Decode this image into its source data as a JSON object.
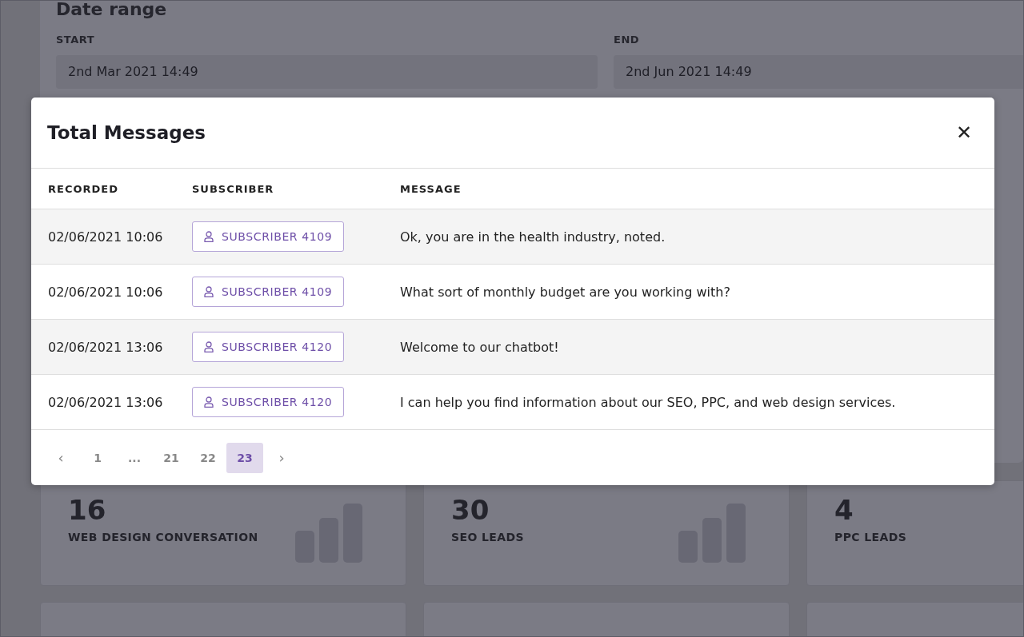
{
  "date_range": {
    "title": "Date range",
    "start": {
      "label": "START",
      "value": "2nd Mar 2021 14:49"
    },
    "end": {
      "label": "END",
      "value": "2nd Jun 2021 14:49"
    }
  },
  "stats": [
    {
      "value": "16",
      "label": "WEB DESIGN CONVERSATION"
    },
    {
      "value": "30",
      "label": "SEO LEADS"
    },
    {
      "value": "4",
      "label": "PPC LEADS"
    }
  ],
  "modal": {
    "title": "Total Messages",
    "close": "✕",
    "table": {
      "columns": [
        "RECORDED",
        "SUBSCRIBER",
        "MESSAGE"
      ],
      "rows": [
        {
          "recorded": "02/06/2021 10:06",
          "subscriber": "SUBSCRIBER 4109",
          "message": "Ok, you are in the health industry, noted."
        },
        {
          "recorded": "02/06/2021 10:06",
          "subscriber": "SUBSCRIBER 4109",
          "message": "What sort of monthly budget are you working with?"
        },
        {
          "recorded": "02/06/2021 13:06",
          "subscriber": "SUBSCRIBER 4120",
          "message": "Welcome to our chatbot!"
        },
        {
          "recorded": "02/06/2021 13:06",
          "subscriber": "SUBSCRIBER 4120",
          "message": "I can help you find information about our SEO, PPC, and web design services."
        }
      ]
    },
    "pagination": [
      {
        "label": "‹",
        "kind": "arrow"
      },
      {
        "label": "1",
        "kind": "page",
        "selected": false
      },
      {
        "label": "...",
        "kind": "ellipsis"
      },
      {
        "label": "21",
        "kind": "page",
        "selected": false
      },
      {
        "label": "22",
        "kind": "page",
        "selected": false
      },
      {
        "label": "23",
        "kind": "page",
        "selected": true
      },
      {
        "label": "›",
        "kind": "arrow"
      }
    ]
  }
}
